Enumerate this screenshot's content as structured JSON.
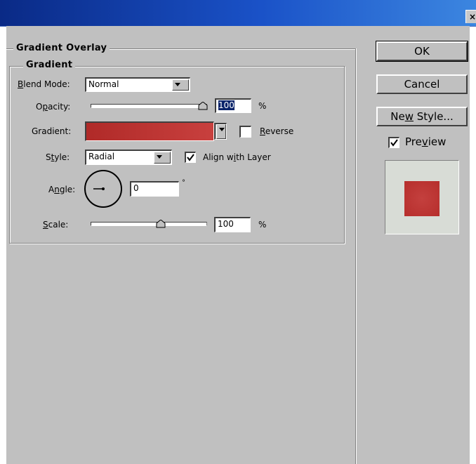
{
  "window": {
    "close_glyph": "×"
  },
  "panel": {
    "section_title": "Gradient Overlay",
    "group_title": "Gradient"
  },
  "blend_mode": {
    "label_u": "B",
    "label_rest": "lend Mode:",
    "value": "Normal"
  },
  "opacity": {
    "label_a": "O",
    "label_u": "p",
    "label_b": "acity:",
    "value": "100",
    "unit": "%",
    "level_percent": 100
  },
  "gradient": {
    "label": "Gradient:",
    "colors": [
      "#b02a28",
      "#c8403e"
    ]
  },
  "reverse": {
    "label_u": "R",
    "label_rest": "everse",
    "checked": false
  },
  "style": {
    "label_a": "S",
    "label_u": "t",
    "label_b": "yle:",
    "value": "Radial"
  },
  "align": {
    "label_a": "Align w",
    "label_u": "i",
    "label_b": "th Layer",
    "checked": true
  },
  "angle": {
    "label_a": "A",
    "label_u": "n",
    "label_b": "gle:",
    "value": "0",
    "unit": "°"
  },
  "scale": {
    "label_u": "S",
    "label_rest": "cale:",
    "value": "100",
    "unit": "%",
    "level_percent": 100
  },
  "buttons": {
    "ok": "OK",
    "cancel": "Cancel",
    "new_style_a": "Ne",
    "new_style_u": "w",
    "new_style_b": " Style..."
  },
  "preview": {
    "label_a": "Pre",
    "label_u": "v",
    "label_b": "iew",
    "checked": true,
    "swatch_color": "#b83230"
  },
  "colors": {
    "titlebar": "#0a2a86",
    "face": "#c0c0c0",
    "selection": "#0a246a"
  }
}
